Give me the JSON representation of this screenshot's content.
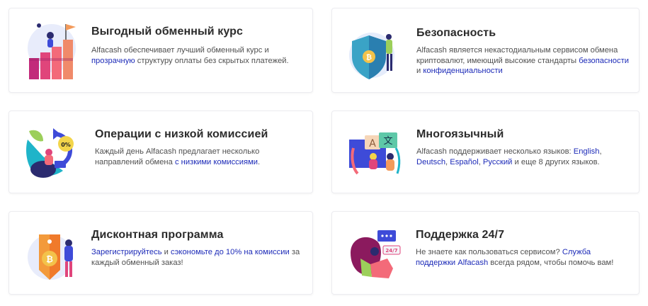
{
  "cards": [
    {
      "title": "Выгодный обменный курс",
      "desc": [
        {
          "t": "Alfacash обеспечивает лучший обменный курс и "
        },
        {
          "t": "прозрачную",
          "link": true
        },
        {
          "t": " структуру оплаты без скрытых платежей."
        }
      ],
      "icon": "exchange-rate-chart-icon"
    },
    {
      "title": "Безопасность",
      "desc": [
        {
          "t": "Alfacash является некастодиальным сервисом обмена криптовалют, имеющий высокие стандарты "
        },
        {
          "t": "безопасности",
          "link": true
        },
        {
          "t": " и "
        },
        {
          "t": "конфиденциальности",
          "link": true
        }
      ],
      "icon": "security-shield-icon"
    },
    {
      "title": "Операции с низкой комиссией",
      "desc": [
        {
          "t": "Каждый день Alfacash предлагает несколько направлений обмена "
        },
        {
          "t": "с низкими комиссиями",
          "link": true
        },
        {
          "t": "."
        }
      ],
      "icon": "low-fee-icon",
      "badge": "0%"
    },
    {
      "title": "Многоязычный",
      "desc": [
        {
          "t": "Alfacash поддерживает несколько языков: "
        },
        {
          "t": "English",
          "link": true
        },
        {
          "t": ", "
        },
        {
          "t": "Deutsch",
          "link": true
        },
        {
          "t": ", "
        },
        {
          "t": "Español",
          "link": true
        },
        {
          "t": ", "
        },
        {
          "t": "Русский",
          "link": true
        },
        {
          "t": " и еще 8 других языков."
        }
      ],
      "icon": "translate-icon",
      "glyph_a": "A",
      "glyph_b": "文"
    },
    {
      "title": "Дисконтная программа",
      "desc": [
        {
          "t": "Зарегистрируйтесь",
          "link": true
        },
        {
          "t": " и "
        },
        {
          "t": "сэкономьте до 10% на комиссии",
          "link": true
        },
        {
          "t": " за каждый обменный заказ!"
        }
      ],
      "icon": "discount-tag-icon"
    },
    {
      "title": "Поддержка 24/7",
      "desc": [
        {
          "t": "Не знаете как пользоваться сервисом? "
        },
        {
          "t": "Служба поддержки Alfacash",
          "link": true
        },
        {
          "t": " всегда рядом, чтобы помочь вам!"
        }
      ],
      "icon": "support-chat-icon",
      "badge": "24/7"
    }
  ]
}
